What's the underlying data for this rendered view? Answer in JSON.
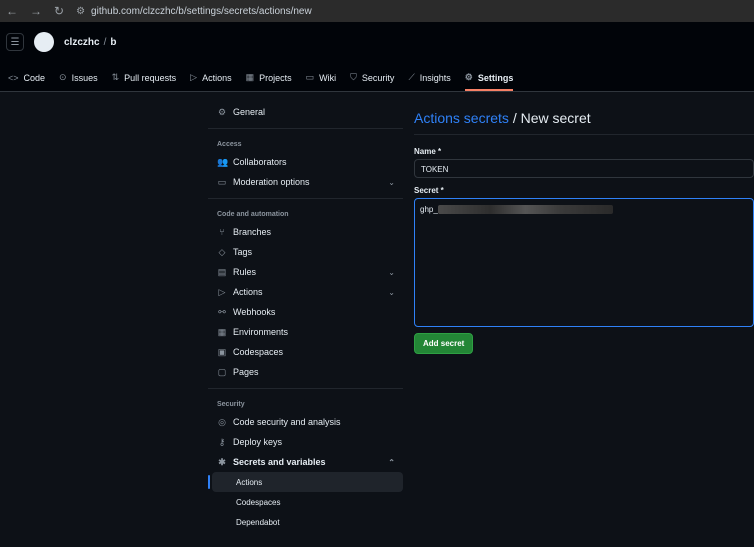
{
  "browser": {
    "url": "github.com/clzczhc/b/settings/secrets/actions/new"
  },
  "repo": {
    "owner": "clzczhc",
    "name": "b"
  },
  "tabs": [
    {
      "label": "Code",
      "icon": "code-icon"
    },
    {
      "label": "Issues",
      "icon": "issue-icon"
    },
    {
      "label": "Pull requests",
      "icon": "pull-request-icon"
    },
    {
      "label": "Actions",
      "icon": "play-icon"
    },
    {
      "label": "Projects",
      "icon": "table-icon"
    },
    {
      "label": "Wiki",
      "icon": "book-icon"
    },
    {
      "label": "Security",
      "icon": "shield-icon"
    },
    {
      "label": "Insights",
      "icon": "graph-icon"
    },
    {
      "label": "Settings",
      "icon": "gear-icon",
      "active": true
    }
  ],
  "sidebar": {
    "general": "General",
    "access_heading": "Access",
    "collaborators": "Collaborators",
    "moderation": "Moderation options",
    "code_heading": "Code and automation",
    "branches": "Branches",
    "tags": "Tags",
    "rules": "Rules",
    "actions": "Actions",
    "webhooks": "Webhooks",
    "environments": "Environments",
    "codespaces": "Codespaces",
    "pages": "Pages",
    "security_heading": "Security",
    "code_security": "Code security and analysis",
    "deploy_keys": "Deploy keys",
    "secrets": "Secrets and variables",
    "sub_actions": "Actions",
    "sub_codespaces": "Codespaces",
    "sub_dependabot": "Dependabot"
  },
  "main": {
    "breadcrumb_link": "Actions secrets",
    "breadcrumb_rest": " / New secret",
    "name_label": "Name *",
    "name_value": "TOKEN",
    "secret_label": "Secret *",
    "secret_prefix": "ghp_",
    "submit": "Add secret"
  },
  "colors": {
    "accent": "#2f81f7",
    "primary_button": "#238636",
    "active_tab": "#f78166"
  }
}
